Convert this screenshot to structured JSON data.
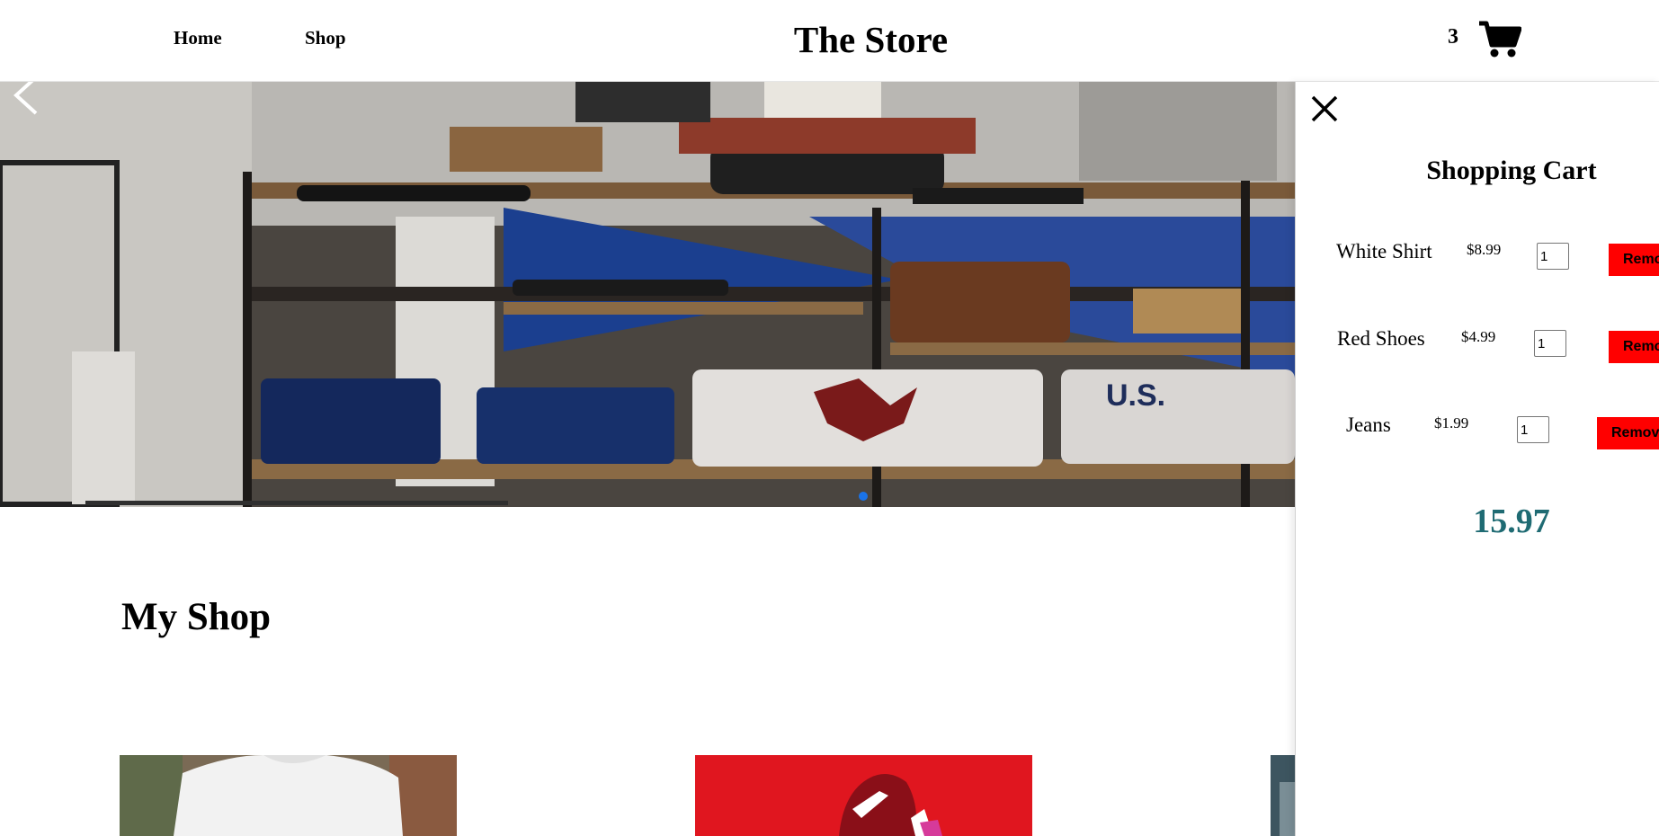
{
  "nav": {
    "home_label": "Home",
    "shop_label": "Shop"
  },
  "brand": {
    "title": "The Store"
  },
  "cart_button": {
    "count": "3",
    "icon": "shopping-cart-icon"
  },
  "hero": {
    "prev_icon": "chevron-left-icon",
    "active_slide_color": "#1a73e8"
  },
  "main": {
    "title": "My Shop",
    "products": [
      {
        "image": "white-shirt-image"
      },
      {
        "image": "red-shoes-image"
      },
      {
        "image": "jeans-image"
      }
    ]
  },
  "cart": {
    "close_icon": "close-icon",
    "title": "Shopping Cart",
    "items": [
      {
        "name": "White Shirt",
        "price": "$8.99",
        "qty": "1",
        "remove_label": "Remove"
      },
      {
        "name": "Red Shoes",
        "price": "$4.99",
        "qty": "1",
        "remove_label": "Remove"
      },
      {
        "name": "Jeans",
        "price": "$1.99",
        "qty": "1",
        "remove_label": "Remove"
      }
    ],
    "total": "15.97",
    "total_color": "#1f6b73",
    "remove_color": "#ff0000"
  }
}
